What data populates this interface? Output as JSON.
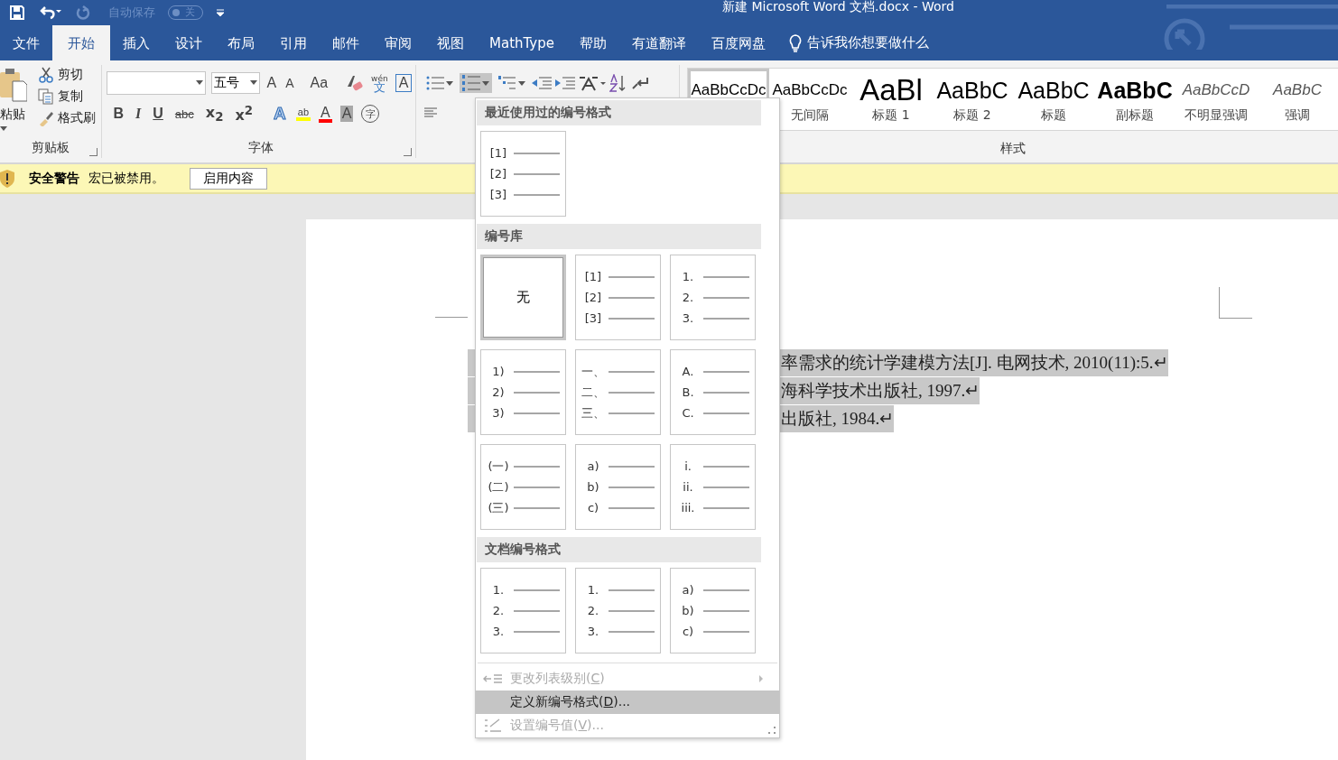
{
  "title_bar": {
    "autosave": {
      "label": "自动保存",
      "state": "关",
      "on": false
    },
    "title": "新建 Microsoft Word 文档.docx  -  Word"
  },
  "tabs": [
    {
      "label": "文件",
      "selected": false
    },
    {
      "label": "开始",
      "selected": true
    },
    {
      "label": "插入",
      "selected": false
    },
    {
      "label": "设计",
      "selected": false
    },
    {
      "label": "布局",
      "selected": false
    },
    {
      "label": "引用",
      "selected": false
    },
    {
      "label": "邮件",
      "selected": false
    },
    {
      "label": "审阅",
      "selected": false
    },
    {
      "label": "视图",
      "selected": false
    },
    {
      "label": "MathType",
      "selected": false
    },
    {
      "label": "帮助",
      "selected": false
    },
    {
      "label": "有道翻译",
      "selected": false
    },
    {
      "label": "百度网盘",
      "selected": false
    }
  ],
  "tell_me": "告诉我你想要做什么",
  "clipboard": {
    "paste": "粘贴",
    "cut": "剪切",
    "copy": "复制",
    "format_painter": "格式刷",
    "label": "剪贴板"
  },
  "font": {
    "size": "五号",
    "label": "字体",
    "grow": "A",
    "shrink": "A",
    "change_case": "Aa",
    "pinyin": "wén",
    "pinyin_char": "文",
    "border_char": "A",
    "bold": "B",
    "italic": "I",
    "underline": "U",
    "strike": "abc",
    "sub": "x",
    "sub_mark": "2",
    "sup": "x",
    "sup_mark": "2",
    "effects": "A",
    "highlight": "ab",
    "font_color": "A",
    "shading": "A",
    "enclose": "字"
  },
  "paragraph": {
    "numbering_open": true
  },
  "styles": {
    "label": "样式",
    "items": [
      {
        "preview": "AaBbCcDc",
        "kind": "normal",
        "selected": true
      },
      {
        "preview": "AaBbCcDc",
        "name": "无间隔",
        "kind": "normal",
        "selected": false
      },
      {
        "preview": "AaBl",
        "name": "标题 1",
        "kind": "h1",
        "selected": false
      },
      {
        "preview": "AaBbC",
        "name": "标题 2",
        "kind": "h2",
        "selected": false
      },
      {
        "preview": "AaBbC",
        "name": "标题",
        "kind": "h2",
        "selected": false
      },
      {
        "preview": "AaBbC",
        "name": "副标题",
        "kind": "bold",
        "selected": false
      },
      {
        "preview": "AaBbCcD",
        "name": "不明显强调",
        "kind": "italic",
        "selected": false
      },
      {
        "preview": "AaBbC",
        "name": "强调",
        "kind": "italic",
        "selected": false
      }
    ]
  },
  "message_bar": {
    "title": "安全警告",
    "text": "宏已被禁用。",
    "button": "启用内容"
  },
  "document": {
    "lines": [
      "率需求的统计学建模方法[J]. 电网技术, 2010(11):5.↵",
      "海科学技术出版社, 1997.↵",
      "出版社, 1984.↵"
    ]
  },
  "numbering_menu": {
    "sections": [
      {
        "header": "最近使用过的编号格式",
        "tiles": [
          {
            "kind": "list",
            "markers": [
              "[1]",
              "[2]",
              "[3]"
            ],
            "selected": false
          }
        ]
      },
      {
        "header": "编号库",
        "tiles": [
          {
            "kind": "none",
            "label": "无",
            "selected": true
          },
          {
            "kind": "list",
            "markers": [
              "[1]",
              "[2]",
              "[3]"
            ],
            "selected": false
          },
          {
            "kind": "list",
            "markers": [
              "1.",
              "2.",
              "3."
            ],
            "selected": false
          },
          {
            "kind": "list",
            "markers": [
              "1)",
              "2)",
              "3)"
            ],
            "selected": false
          },
          {
            "kind": "list",
            "markers": [
              "一、",
              "二、",
              "三、"
            ],
            "selected": false
          },
          {
            "kind": "list",
            "markers": [
              "A.",
              "B.",
              "C."
            ],
            "selected": false
          },
          {
            "kind": "list",
            "markers": [
              "(一)",
              "(二)",
              "(三)"
            ],
            "selected": false
          },
          {
            "kind": "list",
            "markers": [
              "a)",
              "b)",
              "c)"
            ],
            "selected": false
          },
          {
            "kind": "list",
            "markers": [
              "i.",
              "ii.",
              "iii."
            ],
            "selected": false
          }
        ]
      },
      {
        "header": "文档编号格式",
        "tiles": [
          {
            "kind": "list",
            "markers": [
              "1.",
              "2.",
              "3."
            ],
            "selected": false
          },
          {
            "kind": "list",
            "markers": [
              "1.",
              "2.",
              "3."
            ],
            "selected": false
          },
          {
            "kind": "list",
            "markers": [
              "a)",
              "b)",
              "c)"
            ],
            "selected": false
          }
        ]
      }
    ],
    "commands": [
      {
        "kind": "level",
        "before": "更改列表级别(",
        "key": "C",
        "after": ")",
        "disabled": true,
        "selected": false,
        "submenu": true
      },
      {
        "kind": "define",
        "before": "定义新编号格式(",
        "key": "D",
        "after": ")...",
        "disabled": false,
        "selected": true,
        "submenu": false
      },
      {
        "kind": "value",
        "before": "设置编号值(",
        "key": "V",
        "after": ")...",
        "disabled": true,
        "selected": false,
        "submenu": false
      }
    ]
  }
}
